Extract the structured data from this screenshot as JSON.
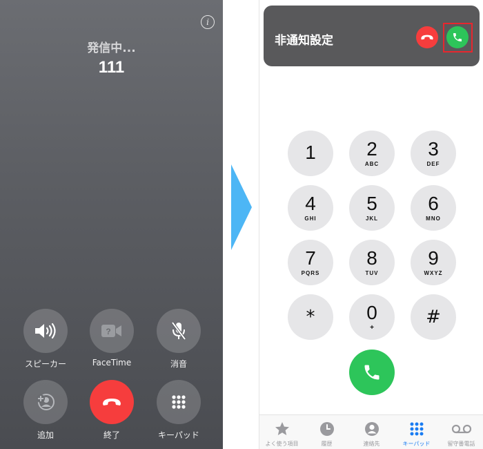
{
  "call_screen": {
    "status": "発信中...",
    "number": "111",
    "controls": [
      {
        "label": "スピーカー",
        "icon": "speaker-icon"
      },
      {
        "label": "FaceTime",
        "icon": "facetime-icon"
      },
      {
        "label": "消音",
        "icon": "mute-icon"
      },
      {
        "label": "追加",
        "icon": "add-call-icon"
      },
      {
        "label": "終了",
        "icon": "end-call-icon"
      },
      {
        "label": "キーパッド",
        "icon": "keypad-icon"
      }
    ]
  },
  "dialer": {
    "banner": {
      "title": "非通知設定"
    },
    "keys": [
      {
        "digit": "1",
        "letters": ""
      },
      {
        "digit": "2",
        "letters": "ABC"
      },
      {
        "digit": "3",
        "letters": "DEF"
      },
      {
        "digit": "4",
        "letters": "GHI"
      },
      {
        "digit": "5",
        "letters": "JKL"
      },
      {
        "digit": "6",
        "letters": "MNO"
      },
      {
        "digit": "7",
        "letters": "PQRS"
      },
      {
        "digit": "8",
        "letters": "TUV"
      },
      {
        "digit": "9",
        "letters": "WXYZ"
      },
      {
        "digit": "*",
        "letters": ""
      },
      {
        "digit": "0",
        "letters": "+"
      },
      {
        "digit": "#",
        "letters": ""
      }
    ],
    "tabs": [
      {
        "label": "よく使う項目",
        "icon": "star-icon"
      },
      {
        "label": "履歴",
        "icon": "clock-icon"
      },
      {
        "label": "連絡先",
        "icon": "contact-icon"
      },
      {
        "label": "キーパッド",
        "icon": "keypad-icon",
        "active": true
      },
      {
        "label": "留守番電話",
        "icon": "voicemail-icon"
      }
    ]
  },
  "colors": {
    "end_red": "#f63d3d",
    "accept_green": "#2dc55a",
    "highlight_red": "#e8262e",
    "arrow_blue": "#4db6f5",
    "tab_active_blue": "#1a7cf2"
  }
}
